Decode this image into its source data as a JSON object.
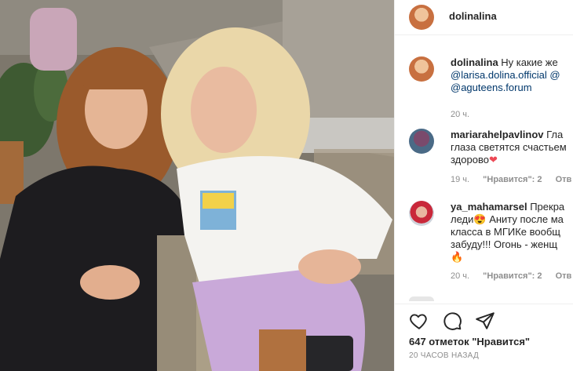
{
  "header": {
    "username": "dolinalina"
  },
  "caption": {
    "username": "dolinalina",
    "text": "Ну какие же",
    "mentions": [
      "@larisa.dolina.official",
      "@",
      "@aguteens.forum"
    ],
    "time": "20 ч."
  },
  "comments": [
    {
      "username": "mariarahelpavlinov",
      "line1": "Гла",
      "line2": "глаза светятся счастьем",
      "line3": "здорово",
      "emoji": "❤",
      "time": "19 ч.",
      "likes": "\"Нравится\": 2",
      "reply": "Отв"
    },
    {
      "username": "ya_mahamarsel",
      "line1": "Прекра",
      "line2": "леди",
      "line2_emoji": "😍",
      "line2_rest": " Аниту после ма",
      "line3": "класса в МГИКе вообщ",
      "line4": "забуду!!! Огонь - женщ",
      "emoji": "🔥",
      "time": "20 ч.",
      "likes": "\"Нравится\": 2",
      "reply": "Отв"
    }
  ],
  "footer": {
    "likes_text": "647 отметок \"Нравится\"",
    "posted_ago": "20 ЧАСОВ НАЗАД"
  },
  "icons": [
    "heart-outline-icon",
    "comment-icon",
    "share-icon"
  ]
}
